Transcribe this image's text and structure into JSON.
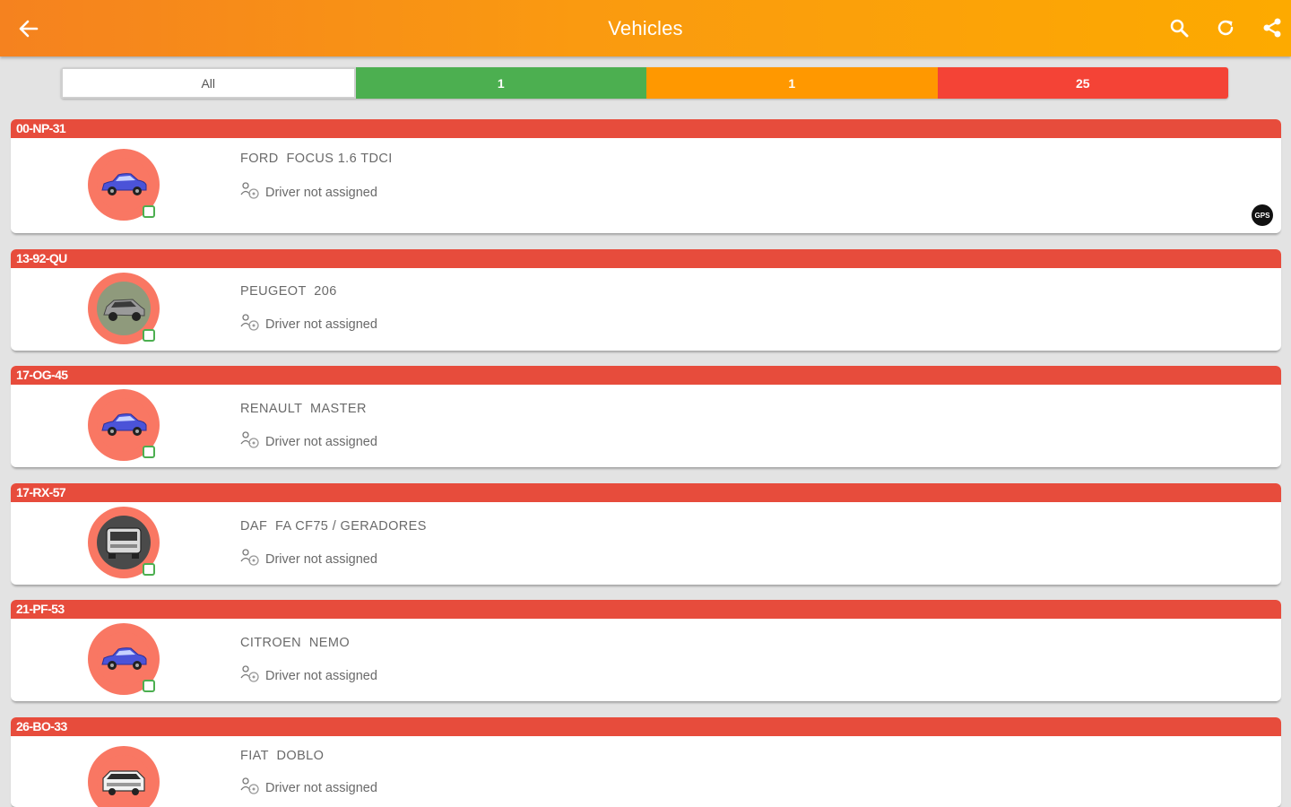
{
  "appbar": {
    "title": "Vehicles",
    "icons": [
      "back-arrow-icon",
      "search-icon",
      "refresh-icon",
      "share-icon"
    ]
  },
  "filter": {
    "all_label": "All",
    "green_count": "1",
    "orange_count": "1",
    "red_count": "25",
    "colors": {
      "green": "#4caf50",
      "orange": "#ff9800",
      "red": "#f44336"
    }
  },
  "vehicles": [
    {
      "plate": "00-NP-31",
      "model": "FORD  FOCUS 1.6 TDCI",
      "driver": "Driver not assigned",
      "icon": "blue-car-icon",
      "badge": "GPS"
    },
    {
      "plate": "13-92-QU",
      "model": "PEUGEOT  206",
      "driver": "Driver not assigned",
      "icon": "gray-car-icon"
    },
    {
      "plate": "17-OG-45",
      "model": "RENAULT  MASTER",
      "driver": "Driver not assigned",
      "icon": "blue-car-icon"
    },
    {
      "plate": "17-RX-57",
      "model": "DAF  FA CF75 / GERADORES",
      "driver": "Driver not assigned",
      "icon": "truck-icon"
    },
    {
      "plate": "21-PF-53",
      "model": "CITROEN  NEMO",
      "driver": "Driver not assigned",
      "icon": "blue-car-icon"
    },
    {
      "plate": "26-BO-33",
      "model": "FIAT  DOBLO",
      "driver": "Driver not assigned",
      "icon": "white-van-icon"
    }
  ],
  "colors": {
    "appbar_start": "#f5821f",
    "appbar_end": "#fdaa00",
    "plate_bar": "#e74c3c",
    "avatar_bg": "#f97763"
  }
}
